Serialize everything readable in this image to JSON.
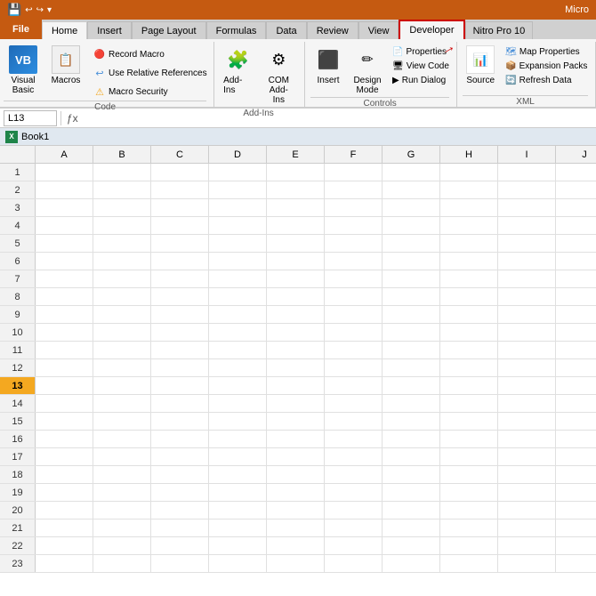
{
  "titlebar": {
    "title": "Micro"
  },
  "tabs": {
    "items": [
      "File",
      "Home",
      "Insert",
      "Page Layout",
      "Formulas",
      "Data",
      "Review",
      "View",
      "Developer",
      "Nitro Pro 10"
    ]
  },
  "ribbon": {
    "groups": {
      "code": {
        "label": "Code",
        "visual_basic_label": "Visual\nBasic",
        "macros_label": "Macros",
        "record_macro": "Record Macro",
        "use_relative": "Use Relative References",
        "macro_security": "Macro Security"
      },
      "addins": {
        "label": "Add-Ins",
        "addins_btn": "Add-Ins",
        "com_addins": "COM\nAdd-Ins"
      },
      "controls": {
        "label": "Controls",
        "insert": "Insert",
        "design_mode": "Design\nMode",
        "properties": "Properties",
        "view_code": "View Code",
        "run_dialog": "Run Dialog"
      },
      "xml": {
        "label": "XML",
        "source": "Source",
        "expansion_packs": "Expansion Packs",
        "refresh_data": "Refresh Data",
        "map_properties": "Map Properties"
      }
    }
  },
  "formula_bar": {
    "cell_ref": "L13",
    "formula": ""
  },
  "workbook": {
    "title": "Book1"
  },
  "columns": [
    "A",
    "B",
    "C",
    "D",
    "E",
    "F",
    "G",
    "H",
    "I",
    "J"
  ],
  "rows": [
    1,
    2,
    3,
    4,
    5,
    6,
    7,
    8,
    9,
    10,
    11,
    12,
    13,
    14,
    15,
    16,
    17,
    18,
    19,
    20,
    21,
    22,
    23
  ],
  "active_row": 13,
  "annotations": {
    "developer_tab_label": "Developer",
    "arrow1_label": "↑",
    "arrow2_label": "↑"
  }
}
